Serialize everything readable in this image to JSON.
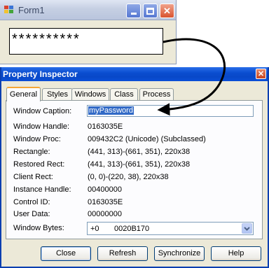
{
  "form1": {
    "title": "Form1",
    "password_mask": "**********"
  },
  "inspector": {
    "title": "Property Inspector",
    "tabs": [
      {
        "label": "General",
        "active": true
      },
      {
        "label": "Styles"
      },
      {
        "label": "Windows"
      },
      {
        "label": "Class"
      },
      {
        "label": "Process"
      }
    ],
    "fields": {
      "caption_label": "Window Caption:",
      "caption_value": "myPassword",
      "handle_label": "Window Handle:",
      "handle_value": "0163035E",
      "proc_label": "Window Proc:",
      "proc_value": "009432C2 (Unicode) (Subclassed)",
      "rect_label": "Rectangle:",
      "rect_value": "(441, 313)-(661, 351), 220x38",
      "restored_label": "Restored Rect:",
      "restored_value": "(441, 313)-(661, 351), 220x38",
      "client_label": "Client Rect:",
      "client_value": "(0, 0)-(220, 38), 220x38",
      "instance_label": "Instance Handle:",
      "instance_value": "00400000",
      "control_label": "Control ID:",
      "control_value": "0163035E",
      "userdata_label": "User Data:",
      "userdata_value": "00000000",
      "bytes_label": "Window Bytes:",
      "bytes_offset": "+0",
      "bytes_value": "0020B170"
    },
    "buttons": {
      "close": "Close",
      "refresh": "Refresh",
      "synchronize": "Synchronize",
      "help": "Help"
    }
  },
  "colors": {
    "title_active": "#0a4ed0",
    "selection": "#3169c6",
    "tab_highlight": "#f5a635"
  }
}
